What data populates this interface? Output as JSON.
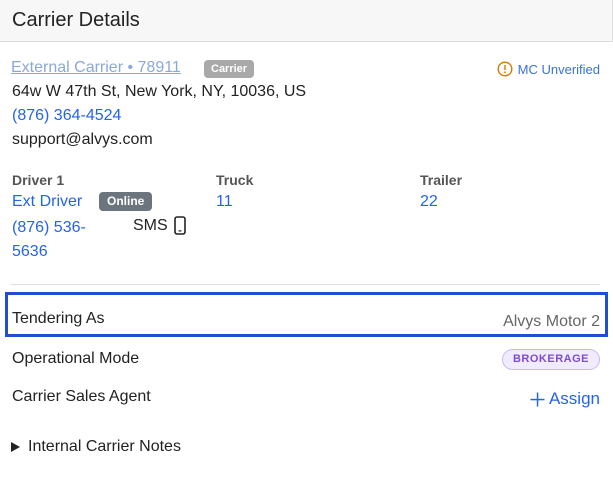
{
  "header": {
    "title": "Carrier Details"
  },
  "carrier": {
    "name": "External Carrier • 78911",
    "badge": "Carrier",
    "mc_status": "MC Unverified",
    "address": "64w W 47th St, New York, NY, 10036, US",
    "phone": "(876) 364-4524",
    "email": "support@alvys.com"
  },
  "driver": {
    "label": "Driver 1",
    "name": "Ext Driver",
    "status": "Online",
    "phone": "(876) 536-5636",
    "sms": "SMS"
  },
  "truck": {
    "label": "Truck",
    "value": "11"
  },
  "trailer": {
    "label": "Trailer",
    "value": "22"
  },
  "tendering": {
    "label": "Tendering As",
    "value": "Alvys Motor 2"
  },
  "operational_mode": {
    "label": "Operational Mode",
    "value": "BROKERAGE"
  },
  "sales_agent": {
    "label": "Carrier Sales Agent",
    "action": "Assign"
  },
  "notes": {
    "label": "Internal Carrier Notes"
  },
  "colors": {
    "link": "#2563eb",
    "faded_link": "#8aa8d8",
    "warning": "#d97706",
    "highlight_border": "#1f4fd0",
    "brokerage_text": "#7c4dcc"
  },
  "icons": {
    "mc_status": "alert-circle-icon",
    "sms": "mobile-phone-icon",
    "assign": "plus-icon",
    "notes": "triangle-right-icon"
  }
}
